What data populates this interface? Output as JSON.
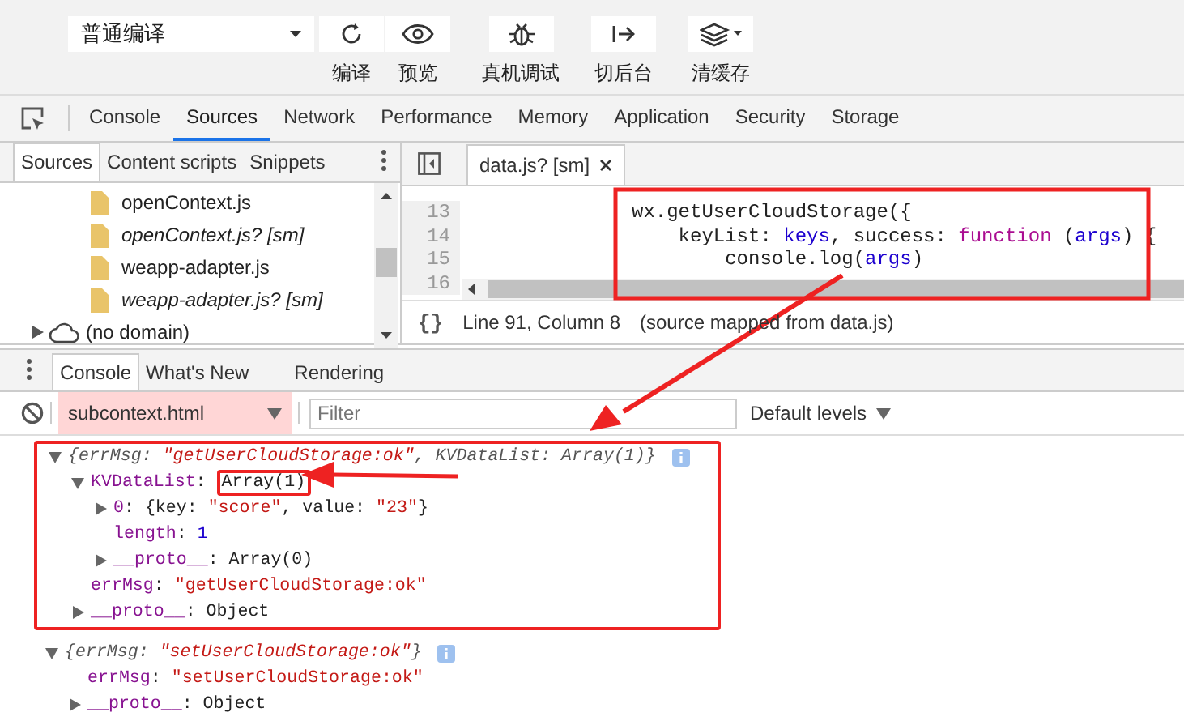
{
  "toolbar": {
    "compile_mode": "普通编译",
    "buttons": [
      {
        "label": "编译"
      },
      {
        "label": "预览"
      },
      {
        "label": "真机调试"
      },
      {
        "label": "切后台"
      },
      {
        "label": "清缓存"
      }
    ]
  },
  "devtools_tabs": [
    {
      "label": "Console",
      "selected": false
    },
    {
      "label": "Sources",
      "selected": true
    },
    {
      "label": "Network",
      "selected": false
    },
    {
      "label": "Performance",
      "selected": false
    },
    {
      "label": "Memory",
      "selected": false
    },
    {
      "label": "Application",
      "selected": false
    },
    {
      "label": "Security",
      "selected": false
    },
    {
      "label": "Storage",
      "selected": false
    }
  ],
  "sources_nav": {
    "tabs": [
      {
        "label": "Sources",
        "selected": true
      },
      {
        "label": "Content scripts",
        "selected": false
      },
      {
        "label": "Snippets",
        "selected": false
      }
    ],
    "items": [
      {
        "label": "openContext.js",
        "kind": "file",
        "source_mapped": false
      },
      {
        "label": "openContext.js? [sm]",
        "kind": "file",
        "source_mapped": true
      },
      {
        "label": "weapp-adapter.js",
        "kind": "file",
        "source_mapped": false
      },
      {
        "label": "weapp-adapter.js? [sm]",
        "kind": "file",
        "source_mapped": true
      },
      {
        "label": "(no domain)",
        "kind": "domain",
        "expanded": false
      }
    ]
  },
  "editor": {
    "tab": "data.js? [sm]",
    "lines": [
      {
        "number": "13",
        "tokens": [
          {
            "kind": "plain",
            "text": "wx.getUserCloudStorage({"
          }
        ]
      },
      {
        "number": "14",
        "tokens": [
          {
            "kind": "plain",
            "text": "    keyList: "
          },
          {
            "kind": "variable",
            "text": "keys"
          },
          {
            "kind": "plain",
            "text": ", success: "
          },
          {
            "kind": "keyword",
            "text": "function"
          },
          {
            "kind": "plain",
            "text": " ("
          },
          {
            "kind": "variable",
            "text": "args"
          },
          {
            "kind": "plain",
            "text": ") {"
          }
        ]
      },
      {
        "number": "15",
        "tokens": [
          {
            "kind": "plain",
            "text": "        console.log("
          },
          {
            "kind": "variable",
            "text": "args"
          },
          {
            "kind": "plain",
            "text": ")"
          }
        ]
      },
      {
        "number": "16"
      }
    ],
    "format_button": "{}",
    "status": {
      "position": "Line 91, Column 8",
      "mapping": "(source mapped from data.js)"
    }
  },
  "drawer_tabs": [
    {
      "label": "Console",
      "selected": true
    },
    {
      "label": "What's New",
      "selected": false
    },
    {
      "label": "Rendering",
      "selected": false
    }
  ],
  "console": {
    "context": "subcontext.html",
    "filter": {
      "placeholder": "Filter"
    },
    "levels": "Default levels",
    "entries": [
      {
        "expanded": true,
        "italic": true,
        "highlighted": true,
        "tokens": [
          {
            "kind": "plain",
            "text": "{errMsg: "
          },
          {
            "kind": "string",
            "text": "\"getUserCloudStorage:ok\""
          },
          {
            "kind": "plain",
            "text": ", KVDataList: Array(1)}"
          }
        ],
        "children": [
          {
            "expanded": true,
            "tokens": [
              {
                "kind": "key",
                "text": "KVDataList"
              },
              {
                "kind": "plain",
                "text": ": "
              },
              {
                "kind": "plain",
                "text": "Array(1)",
                "highlighted": true
              }
            ],
            "children": [
              {
                "expanded": false,
                "tokens": [
                  {
                    "kind": "key",
                    "text": "0"
                  },
                  {
                    "kind": "plain",
                    "text": ": {key: "
                  },
                  {
                    "kind": "string",
                    "text": "\"score\""
                  },
                  {
                    "kind": "plain",
                    "text": ", value: "
                  },
                  {
                    "kind": "string",
                    "text": "\"23\""
                  },
                  {
                    "kind": "plain",
                    "text": "}"
                  }
                ]
              },
              {
                "tokens": [
                  {
                    "kind": "key",
                    "text": "length"
                  },
                  {
                    "kind": "plain",
                    "text": ": "
                  },
                  {
                    "kind": "number",
                    "text": "1"
                  }
                ]
              },
              {
                "expanded": false,
                "tokens": [
                  {
                    "kind": "key",
                    "text": "__proto__"
                  },
                  {
                    "kind": "plain",
                    "text": ": Array(0)"
                  }
                ]
              }
            ]
          },
          {
            "tokens": [
              {
                "kind": "key",
                "text": "errMsg"
              },
              {
                "kind": "plain",
                "text": ": "
              },
              {
                "kind": "string",
                "text": "\"getUserCloudStorage:ok\""
              }
            ]
          },
          {
            "expanded": false,
            "tokens": [
              {
                "kind": "key",
                "text": "__proto__"
              },
              {
                "kind": "plain",
                "text": ": Object"
              }
            ]
          }
        ]
      },
      {
        "expanded": true,
        "italic": true,
        "highlighted": false,
        "tokens": [
          {
            "kind": "plain",
            "text": "{errMsg: "
          },
          {
            "kind": "string",
            "text": "\"setUserCloudStorage:ok\""
          },
          {
            "kind": "plain",
            "text": "}"
          }
        ],
        "children": [
          {
            "tokens": [
              {
                "kind": "key",
                "text": "errMsg"
              },
              {
                "kind": "plain",
                "text": ": "
              },
              {
                "kind": "string",
                "text": "\"setUserCloudStorage:ok\""
              }
            ]
          },
          {
            "expanded": false,
            "tokens": [
              {
                "kind": "key",
                "text": "__proto__"
              },
              {
                "kind": "plain",
                "text": ": Object"
              }
            ]
          }
        ]
      }
    ]
  }
}
